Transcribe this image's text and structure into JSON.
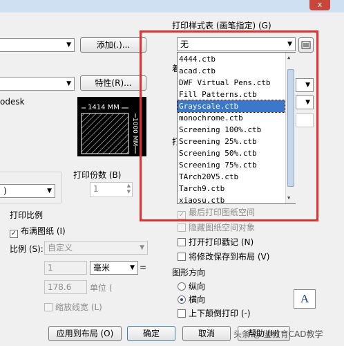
{
  "window": {
    "close_label": "x"
  },
  "plot_style_table": {
    "label": "打印样式表 (画笔指定) (G)",
    "selected": "无",
    "options": [
      "4444.ctb",
      "acad.ctb",
      "DWF Virtual Pens.ctb",
      "Fill Patterns.ctb",
      "Grayscale.ctb",
      "monochrome.ctb",
      "Screening 100%.ctb",
      "Screening 25%.ctb",
      "Screening 50%.ctb",
      "Screening 75%.ctb",
      "TArch20V5.ctb",
      "Tarch9.ctb",
      "xiaosu.ctb"
    ],
    "highlighted_index": 4
  },
  "printer": {
    "add_button": "添加(.)...",
    "properties_button": "特性(R)...",
    "plotter_text": "odesk"
  },
  "preview": {
    "width_label": "1414 MM",
    "height_label": "1000 MM"
  },
  "copies": {
    "label": "打印份数 (B)",
    "value": "1"
  },
  "scale": {
    "section_label": "打印比例",
    "fit_paper": "布满图纸 (I)",
    "scale_label": "比例 (S):",
    "scale_value": "自定义",
    "value1": "1",
    "unit_value": "毫米",
    "equals": "=",
    "value2": "178.6",
    "unit_label": "单位 (",
    "lineweights": "缩放线宽 (L)"
  },
  "options": {
    "truncated_label_1": "着",
    "truncated_label_2": "打",
    "plot_paperspace_last": "最后打印图纸空间",
    "hide_paperspace": "隐藏图纸空间对象",
    "plot_stamp": "打开打印戳记 (N)",
    "save_changes": "将修改保存到布局 (V)"
  },
  "orientation": {
    "label": "图形方向",
    "portrait": "纵向",
    "landscape": "横向",
    "upside_down": "上下颠倒打印 (-)",
    "icon_letter": "A"
  },
  "buttons": {
    "apply": "应用到布局 (O)",
    "ok": "确定",
    "cancel": "取消",
    "help": "帮助 (H)"
  },
  "watermark": "头条 @ 鉴教育CAD教学"
}
